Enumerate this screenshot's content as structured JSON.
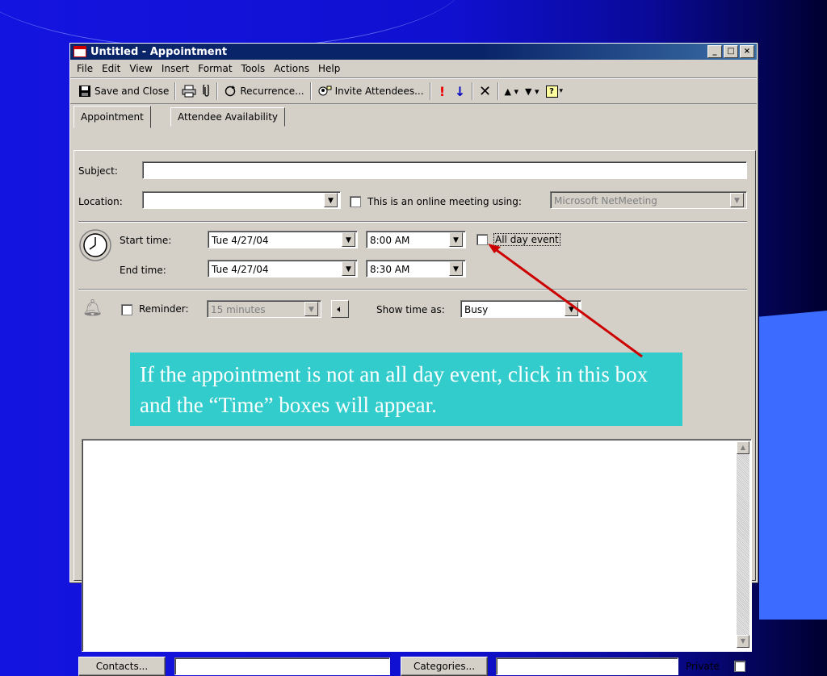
{
  "window": {
    "title": "Untitled - Appointment",
    "controls": [
      "minimize-icon",
      "maximize-icon",
      "close-icon"
    ]
  },
  "menu": [
    "File",
    "Edit",
    "View",
    "Insert",
    "Format",
    "Tools",
    "Actions",
    "Help"
  ],
  "toolbar": {
    "save_close": "Save and Close",
    "recurrence": "Recurrence...",
    "invite": "Invite Attendees...",
    "icons": [
      "print-icon",
      "attach-icon",
      "importance-high-icon",
      "importance-low-icon",
      "delete-icon",
      "previous-item-icon",
      "next-item-icon",
      "help-icon"
    ]
  },
  "tabs": [
    {
      "label": "Appointment"
    },
    {
      "label": "Attendee Availability"
    }
  ],
  "form": {
    "subject_label": "Subject:",
    "subject_value": "",
    "location_label": "Location:",
    "location_value": "",
    "online_meeting_label": "This is an online meeting using:",
    "online_meeting_value": "Microsoft NetMeeting",
    "start_label": "Start time:",
    "start_date": "Tue 4/27/04",
    "start_time": "8:00 AM",
    "all_day_label": "All day event",
    "end_label": "End time:",
    "end_date": "Tue 4/27/04",
    "end_time": "8:30 AM",
    "reminder_label": "Reminder:",
    "reminder_value": "15 minutes",
    "show_time_label": "Show time as:",
    "show_time_value": "Busy"
  },
  "footer": {
    "contacts": "Contacts...",
    "categories": "Categories...",
    "private": "Private"
  },
  "callout": {
    "text": "If the appointment is not an all day event, click in this box and the “Time” boxes will appear."
  },
  "colors": {
    "slide_background": "#1414e0",
    "callout_background": "#33cccc",
    "arrow": "#cc0000",
    "titlebar": "#0a246a"
  }
}
